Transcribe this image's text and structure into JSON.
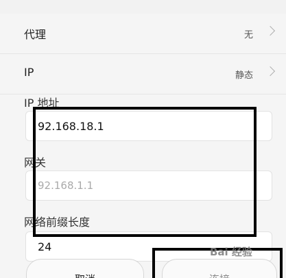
{
  "rows": [
    {
      "label": "代理",
      "value": "无"
    },
    {
      "label": "IP",
      "value": "静态"
    }
  ],
  "fields": {
    "ip_address": {
      "label": "IP 地址",
      "value": "92.168.18.1"
    },
    "gateway": {
      "label": "网关",
      "placeholder": "92.168.1.1"
    },
    "prefix_length": {
      "label": "网络前缀长度",
      "value": "24"
    }
  },
  "buttons": {
    "cancel": "取消",
    "connect": "连接"
  },
  "watermark": "Bai 经验"
}
